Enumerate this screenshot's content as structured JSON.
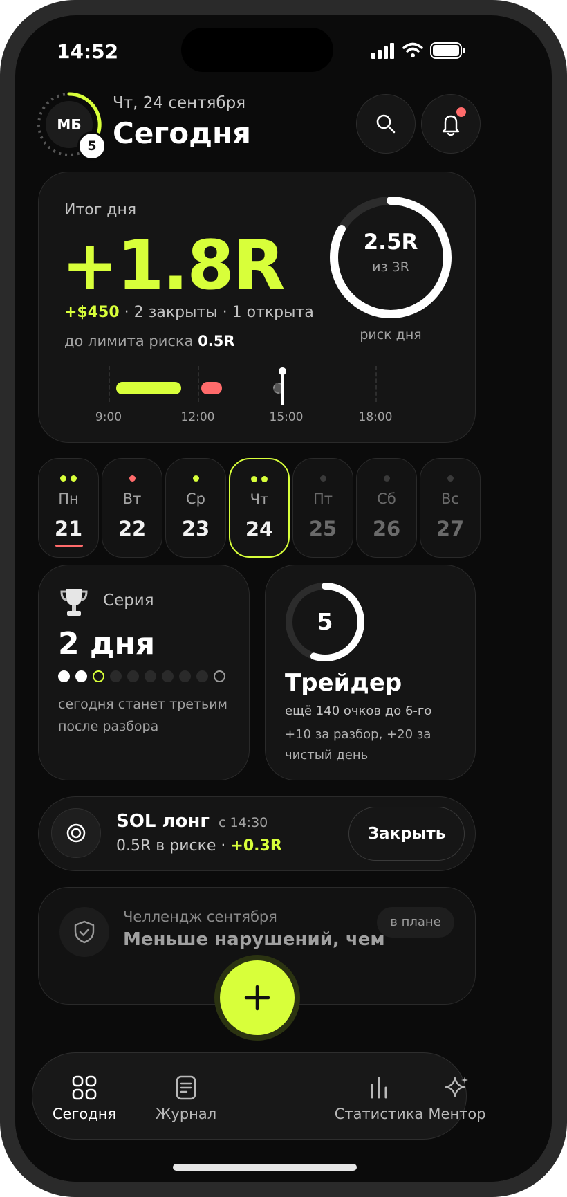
{
  "status_bar": {
    "time": "14:52"
  },
  "header": {
    "avatar_initials": "МБ",
    "avatar_level": "5",
    "date": "Чт, 24 сентября",
    "title": "Сегодня",
    "icons": [
      "search-icon",
      "bell-icon"
    ]
  },
  "summary": {
    "label": "Итог дня",
    "result": "+1.8R",
    "pnl": "+$450",
    "details": "· 2 закрыты · 1 открыта",
    "risk_limit_label": "до лимита риска",
    "risk_limit_value": "0.5R",
    "ring_value": "2.5R",
    "ring_sub": "из 3R",
    "ring_caption": "риск дня",
    "ring_progress": 0.833,
    "timeline_labels": [
      "9:00",
      "12:00",
      "15:00",
      "18:00"
    ]
  },
  "week": [
    {
      "name": "Пн",
      "num": "21",
      "dots": [
        "#d8ff3a",
        "#d8ff3a"
      ],
      "state": "past",
      "underline": true
    },
    {
      "name": "Вт",
      "num": "22",
      "dots": [
        "#ff6b6b"
      ],
      "state": "past"
    },
    {
      "name": "Ср",
      "num": "23",
      "dots": [
        "#d8ff3a"
      ],
      "state": "past"
    },
    {
      "name": "Чт",
      "num": "24",
      "dots": [
        "#d8ff3a",
        "#d8ff3a"
      ],
      "state": "today"
    },
    {
      "name": "Пт",
      "num": "25",
      "dots": [
        "#3a3a3a"
      ],
      "state": "future"
    },
    {
      "name": "Сб",
      "num": "26",
      "dots": [
        "#3a3a3a"
      ],
      "state": "future"
    },
    {
      "name": "Вс",
      "num": "27",
      "dots": [
        "#3a3a3a"
      ],
      "state": "future"
    }
  ],
  "streak": {
    "label": "Серия",
    "value": "2 дня",
    "note_line1": "сегодня станет третьим",
    "note_line2": "после разбора",
    "days_filled": 2,
    "days_total": 10
  },
  "level": {
    "number": "5",
    "title": "Трейдер",
    "progress": 0.55,
    "line1": "ещё 140 очков до 6-го",
    "line2": "+10 за разбор, +20 за",
    "line3": "чистый день"
  },
  "position": {
    "name": "SOL лонг",
    "since": "с 14:30",
    "risk": "0.5R в риске",
    "sep": "·",
    "pnl": "+0.3R",
    "button": "Закрыть"
  },
  "challenge": {
    "label": "Челлендж сентября",
    "title": "Меньше нарушений, чем",
    "badge": "в плане"
  },
  "nav": {
    "items": [
      {
        "label": "Сегодня",
        "icon": "grid-icon",
        "active": true
      },
      {
        "label": "Журнал",
        "icon": "journal-icon"
      },
      {
        "label": "Статистика",
        "icon": "stats-icon"
      },
      {
        "label": "Ментор",
        "icon": "sparkle-icon"
      }
    ],
    "fab_icon": "plus-icon"
  },
  "colors": {
    "accent": "#d8ff3a",
    "loss": "#ff6b6b",
    "background": "#0b0b0b",
    "card": "#151515"
  }
}
